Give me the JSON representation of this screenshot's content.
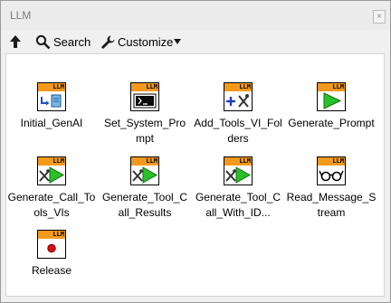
{
  "window": {
    "title": "LLM",
    "close_symbol": "×"
  },
  "toolbar": {
    "up_label": "",
    "search_label": "Search",
    "customize_label": "Customize"
  },
  "band_text": "LLM",
  "items": [
    {
      "label": "Initial_GenAI",
      "icon": "init-icon"
    },
    {
      "label": "Set_System_Prompt",
      "icon": "terminal-prompt-icon"
    },
    {
      "label": "Add_Tools_VI_Folders",
      "icon": "plus-tools-icon"
    },
    {
      "label": "Generate_Prompt",
      "icon": "play-icon"
    },
    {
      "label": "Generate_Call_Tools_VIs",
      "icon": "tools-play-icon"
    },
    {
      "label": "Generate_Tool_Call_Results",
      "icon": "tools-play-icon"
    },
    {
      "label": "Generate_Tool_Call_With_ID...",
      "icon": "tools-play-icon"
    },
    {
      "label": "Read_Message_Stream",
      "icon": "glasses-icon"
    },
    {
      "label": "Release",
      "icon": "stop-record-icon"
    }
  ]
}
